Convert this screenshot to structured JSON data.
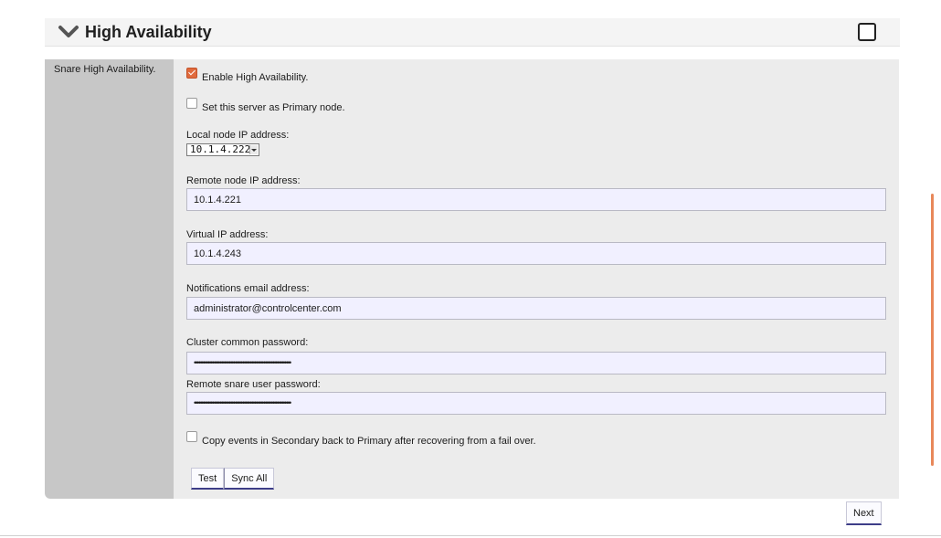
{
  "section": {
    "title": "High Availability",
    "side_label": "Snare High Availability."
  },
  "options": {
    "enable_ha": {
      "label": "Enable High Availability.",
      "checked": true
    },
    "primary_node": {
      "label": "Set this server as Primary node.",
      "checked": false
    },
    "copy_events": {
      "label": "Copy events in Secondary back to Primary after recovering from a fail over.",
      "checked": false
    }
  },
  "fields": {
    "local_ip_label": "Local node IP address:",
    "local_ip_value": "10.1.4.222",
    "remote_ip_label": "Remote node IP address:",
    "remote_ip_value": "10.1.4.221",
    "virtual_ip_label": "Virtual IP address:",
    "virtual_ip_value": "10.1.4.243",
    "email_label": "Notifications email address:",
    "email_value": "administrator@controlcenter.com",
    "cluster_pw_label": "Cluster common password:",
    "cluster_pw_value": "••••••••••••••••••••••••••••••••••••••••••••••••••••••••••••••••",
    "remote_pw_label": "Remote snare user password:",
    "remote_pw_value": "••••••••••••••••••••••••••••••••••••••••••••••••••••••••••••••••"
  },
  "buttons": {
    "test": "Test",
    "sync_all": "Sync All",
    "next": "Next"
  },
  "colors": {
    "accent": "#e06a3d",
    "field_bg": "#f1f0ff",
    "button_border": "#3d3d88"
  }
}
